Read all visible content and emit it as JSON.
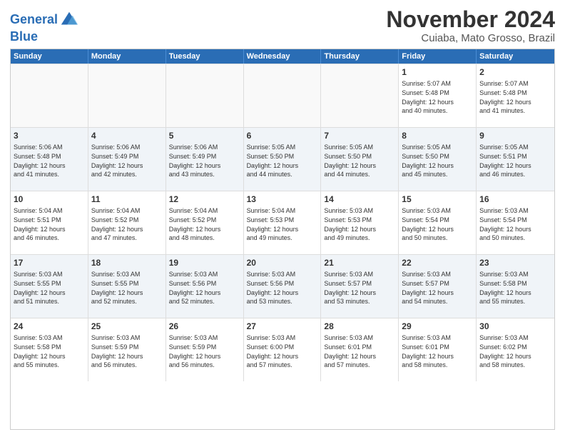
{
  "logo": {
    "line1": "General",
    "line2": "Blue"
  },
  "title": "November 2024",
  "location": "Cuiaba, Mato Grosso, Brazil",
  "weekdays": [
    "Sunday",
    "Monday",
    "Tuesday",
    "Wednesday",
    "Thursday",
    "Friday",
    "Saturday"
  ],
  "rows": [
    [
      {
        "day": "",
        "info": ""
      },
      {
        "day": "",
        "info": ""
      },
      {
        "day": "",
        "info": ""
      },
      {
        "day": "",
        "info": ""
      },
      {
        "day": "",
        "info": ""
      },
      {
        "day": "1",
        "info": "Sunrise: 5:07 AM\nSunset: 5:48 PM\nDaylight: 12 hours\nand 40 minutes."
      },
      {
        "day": "2",
        "info": "Sunrise: 5:07 AM\nSunset: 5:48 PM\nDaylight: 12 hours\nand 41 minutes."
      }
    ],
    [
      {
        "day": "3",
        "info": "Sunrise: 5:06 AM\nSunset: 5:48 PM\nDaylight: 12 hours\nand 41 minutes."
      },
      {
        "day": "4",
        "info": "Sunrise: 5:06 AM\nSunset: 5:49 PM\nDaylight: 12 hours\nand 42 minutes."
      },
      {
        "day": "5",
        "info": "Sunrise: 5:06 AM\nSunset: 5:49 PM\nDaylight: 12 hours\nand 43 minutes."
      },
      {
        "day": "6",
        "info": "Sunrise: 5:05 AM\nSunset: 5:50 PM\nDaylight: 12 hours\nand 44 minutes."
      },
      {
        "day": "7",
        "info": "Sunrise: 5:05 AM\nSunset: 5:50 PM\nDaylight: 12 hours\nand 44 minutes."
      },
      {
        "day": "8",
        "info": "Sunrise: 5:05 AM\nSunset: 5:50 PM\nDaylight: 12 hours\nand 45 minutes."
      },
      {
        "day": "9",
        "info": "Sunrise: 5:05 AM\nSunset: 5:51 PM\nDaylight: 12 hours\nand 46 minutes."
      }
    ],
    [
      {
        "day": "10",
        "info": "Sunrise: 5:04 AM\nSunset: 5:51 PM\nDaylight: 12 hours\nand 46 minutes."
      },
      {
        "day": "11",
        "info": "Sunrise: 5:04 AM\nSunset: 5:52 PM\nDaylight: 12 hours\nand 47 minutes."
      },
      {
        "day": "12",
        "info": "Sunrise: 5:04 AM\nSunset: 5:52 PM\nDaylight: 12 hours\nand 48 minutes."
      },
      {
        "day": "13",
        "info": "Sunrise: 5:04 AM\nSunset: 5:53 PM\nDaylight: 12 hours\nand 49 minutes."
      },
      {
        "day": "14",
        "info": "Sunrise: 5:03 AM\nSunset: 5:53 PM\nDaylight: 12 hours\nand 49 minutes."
      },
      {
        "day": "15",
        "info": "Sunrise: 5:03 AM\nSunset: 5:54 PM\nDaylight: 12 hours\nand 50 minutes."
      },
      {
        "day": "16",
        "info": "Sunrise: 5:03 AM\nSunset: 5:54 PM\nDaylight: 12 hours\nand 50 minutes."
      }
    ],
    [
      {
        "day": "17",
        "info": "Sunrise: 5:03 AM\nSunset: 5:55 PM\nDaylight: 12 hours\nand 51 minutes."
      },
      {
        "day": "18",
        "info": "Sunrise: 5:03 AM\nSunset: 5:55 PM\nDaylight: 12 hours\nand 52 minutes."
      },
      {
        "day": "19",
        "info": "Sunrise: 5:03 AM\nSunset: 5:56 PM\nDaylight: 12 hours\nand 52 minutes."
      },
      {
        "day": "20",
        "info": "Sunrise: 5:03 AM\nSunset: 5:56 PM\nDaylight: 12 hours\nand 53 minutes."
      },
      {
        "day": "21",
        "info": "Sunrise: 5:03 AM\nSunset: 5:57 PM\nDaylight: 12 hours\nand 53 minutes."
      },
      {
        "day": "22",
        "info": "Sunrise: 5:03 AM\nSunset: 5:57 PM\nDaylight: 12 hours\nand 54 minutes."
      },
      {
        "day": "23",
        "info": "Sunrise: 5:03 AM\nSunset: 5:58 PM\nDaylight: 12 hours\nand 55 minutes."
      }
    ],
    [
      {
        "day": "24",
        "info": "Sunrise: 5:03 AM\nSunset: 5:58 PM\nDaylight: 12 hours\nand 55 minutes."
      },
      {
        "day": "25",
        "info": "Sunrise: 5:03 AM\nSunset: 5:59 PM\nDaylight: 12 hours\nand 56 minutes."
      },
      {
        "day": "26",
        "info": "Sunrise: 5:03 AM\nSunset: 5:59 PM\nDaylight: 12 hours\nand 56 minutes."
      },
      {
        "day": "27",
        "info": "Sunrise: 5:03 AM\nSunset: 6:00 PM\nDaylight: 12 hours\nand 57 minutes."
      },
      {
        "day": "28",
        "info": "Sunrise: 5:03 AM\nSunset: 6:01 PM\nDaylight: 12 hours\nand 57 minutes."
      },
      {
        "day": "29",
        "info": "Sunrise: 5:03 AM\nSunset: 6:01 PM\nDaylight: 12 hours\nand 58 minutes."
      },
      {
        "day": "30",
        "info": "Sunrise: 5:03 AM\nSunset: 6:02 PM\nDaylight: 12 hours\nand 58 minutes."
      }
    ]
  ]
}
